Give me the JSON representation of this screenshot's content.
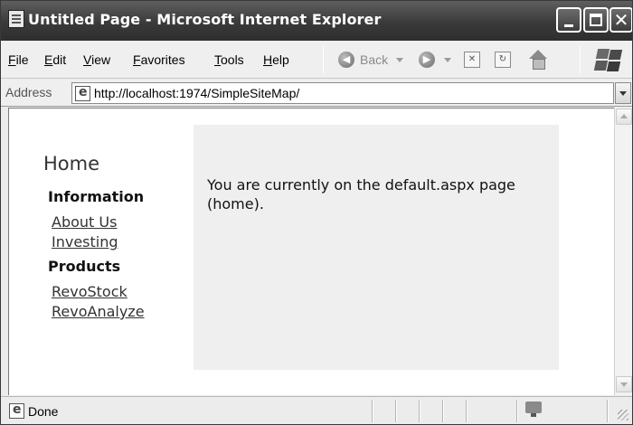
{
  "window": {
    "title": "Untitled Page - Microsoft Internet Explorer"
  },
  "menu": {
    "items": [
      "File",
      "Edit",
      "View",
      "Favorites",
      "Tools",
      "Help"
    ]
  },
  "toolbar": {
    "back_label": "Back"
  },
  "address": {
    "label": "Address",
    "url": "http://localhost:1974/SimpleSiteMap/"
  },
  "sitemap": {
    "root": "Home",
    "sections": [
      {
        "title": "Information",
        "links": [
          "About Us",
          "Investing"
        ]
      },
      {
        "title": "Products",
        "links": [
          "RevoStock",
          "RevoAnalyze"
        ]
      }
    ]
  },
  "content": {
    "text": "You are currently on the default.aspx page (home)."
  },
  "status": {
    "text": "Done"
  }
}
